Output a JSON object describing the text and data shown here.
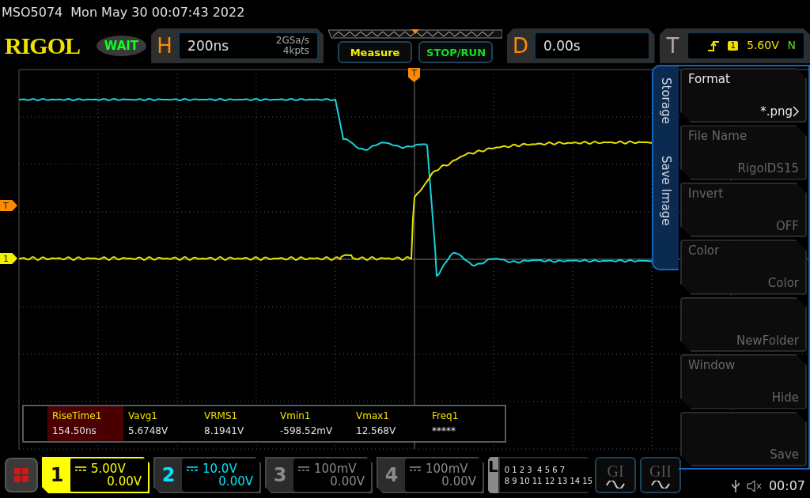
{
  "header": {
    "model": "MSO5074",
    "datetime": "Mon May 30 00:07:43 2022"
  },
  "logo": "RIGOL",
  "run_status": "WAIT",
  "horizontal": {
    "label": "H",
    "timebase": "200ns",
    "sample_rate": "2GSa/s",
    "memory_depth": "4kpts"
  },
  "buttons": [
    {
      "label": "Measure",
      "kind": "measure"
    },
    {
      "label": "STOP/RUN",
      "kind": "run"
    }
  ],
  "delay": {
    "label": "D",
    "value": "0.00s"
  },
  "trigger": {
    "label": "T",
    "source": "1",
    "threshold": "5.60V",
    "sweep": "N"
  },
  "markers": {
    "trigger_position": "T",
    "trigger_level": "T",
    "channel_1": "1"
  },
  "side_menu": {
    "titles": [
      "Storage",
      "Save Image"
    ],
    "items": [
      {
        "label": "Format",
        "value": "*.png",
        "disabled": false,
        "submenu": true
      },
      {
        "label": "File Name",
        "value": "RigolDS15",
        "disabled": true,
        "submenu": false
      },
      {
        "label": "Invert",
        "value": "OFF",
        "disabled": true,
        "submenu": false
      },
      {
        "label": "Color",
        "value": "Color",
        "disabled": true,
        "submenu": false
      },
      {
        "value": "NewFolder",
        "disabled": true,
        "submenu": false
      },
      {
        "label": "Window",
        "value": "Hide",
        "disabled": true,
        "submenu": false
      },
      {
        "value": "Save",
        "disabled": true,
        "submenu": false
      }
    ]
  },
  "measurements": [
    {
      "label": "RiseTime1",
      "value": "154.50ns",
      "selected": true
    },
    {
      "label": "Vavg1",
      "value": "5.6748V",
      "selected": false
    },
    {
      "label": "VRMS1",
      "value": "8.1941V",
      "selected": false
    },
    {
      "label": "Vmin1",
      "value": "-598.52mV",
      "selected": false
    },
    {
      "label": "Vmax1",
      "value": "12.568V",
      "selected": false
    },
    {
      "label": "Freq1",
      "value": "*****",
      "selected": false
    }
  ],
  "channels": [
    {
      "number": "1",
      "scale": "5.00V",
      "offset": "0.00V",
      "selected": true,
      "color": "#ffff00"
    },
    {
      "number": "2",
      "scale": "10.0V",
      "offset": "0.00V",
      "selected": false,
      "color": "#00e5ff"
    },
    {
      "number": "3",
      "scale": "100mV",
      "offset": "0.00V",
      "selected": false,
      "color": "#8a8a8a"
    },
    {
      "number": "4",
      "scale": "100mV",
      "offset": "0.00V",
      "selected": false,
      "color": "#8a8a8a"
    }
  ],
  "logic": {
    "label": "L",
    "rows": [
      "0 1 2 3  4 5 6 7",
      "8 9 10 11 12 13 14 15"
    ]
  },
  "generators": [
    {
      "label": "GI"
    },
    {
      "label": "GII"
    }
  ],
  "status": {
    "time": "00:07"
  }
}
